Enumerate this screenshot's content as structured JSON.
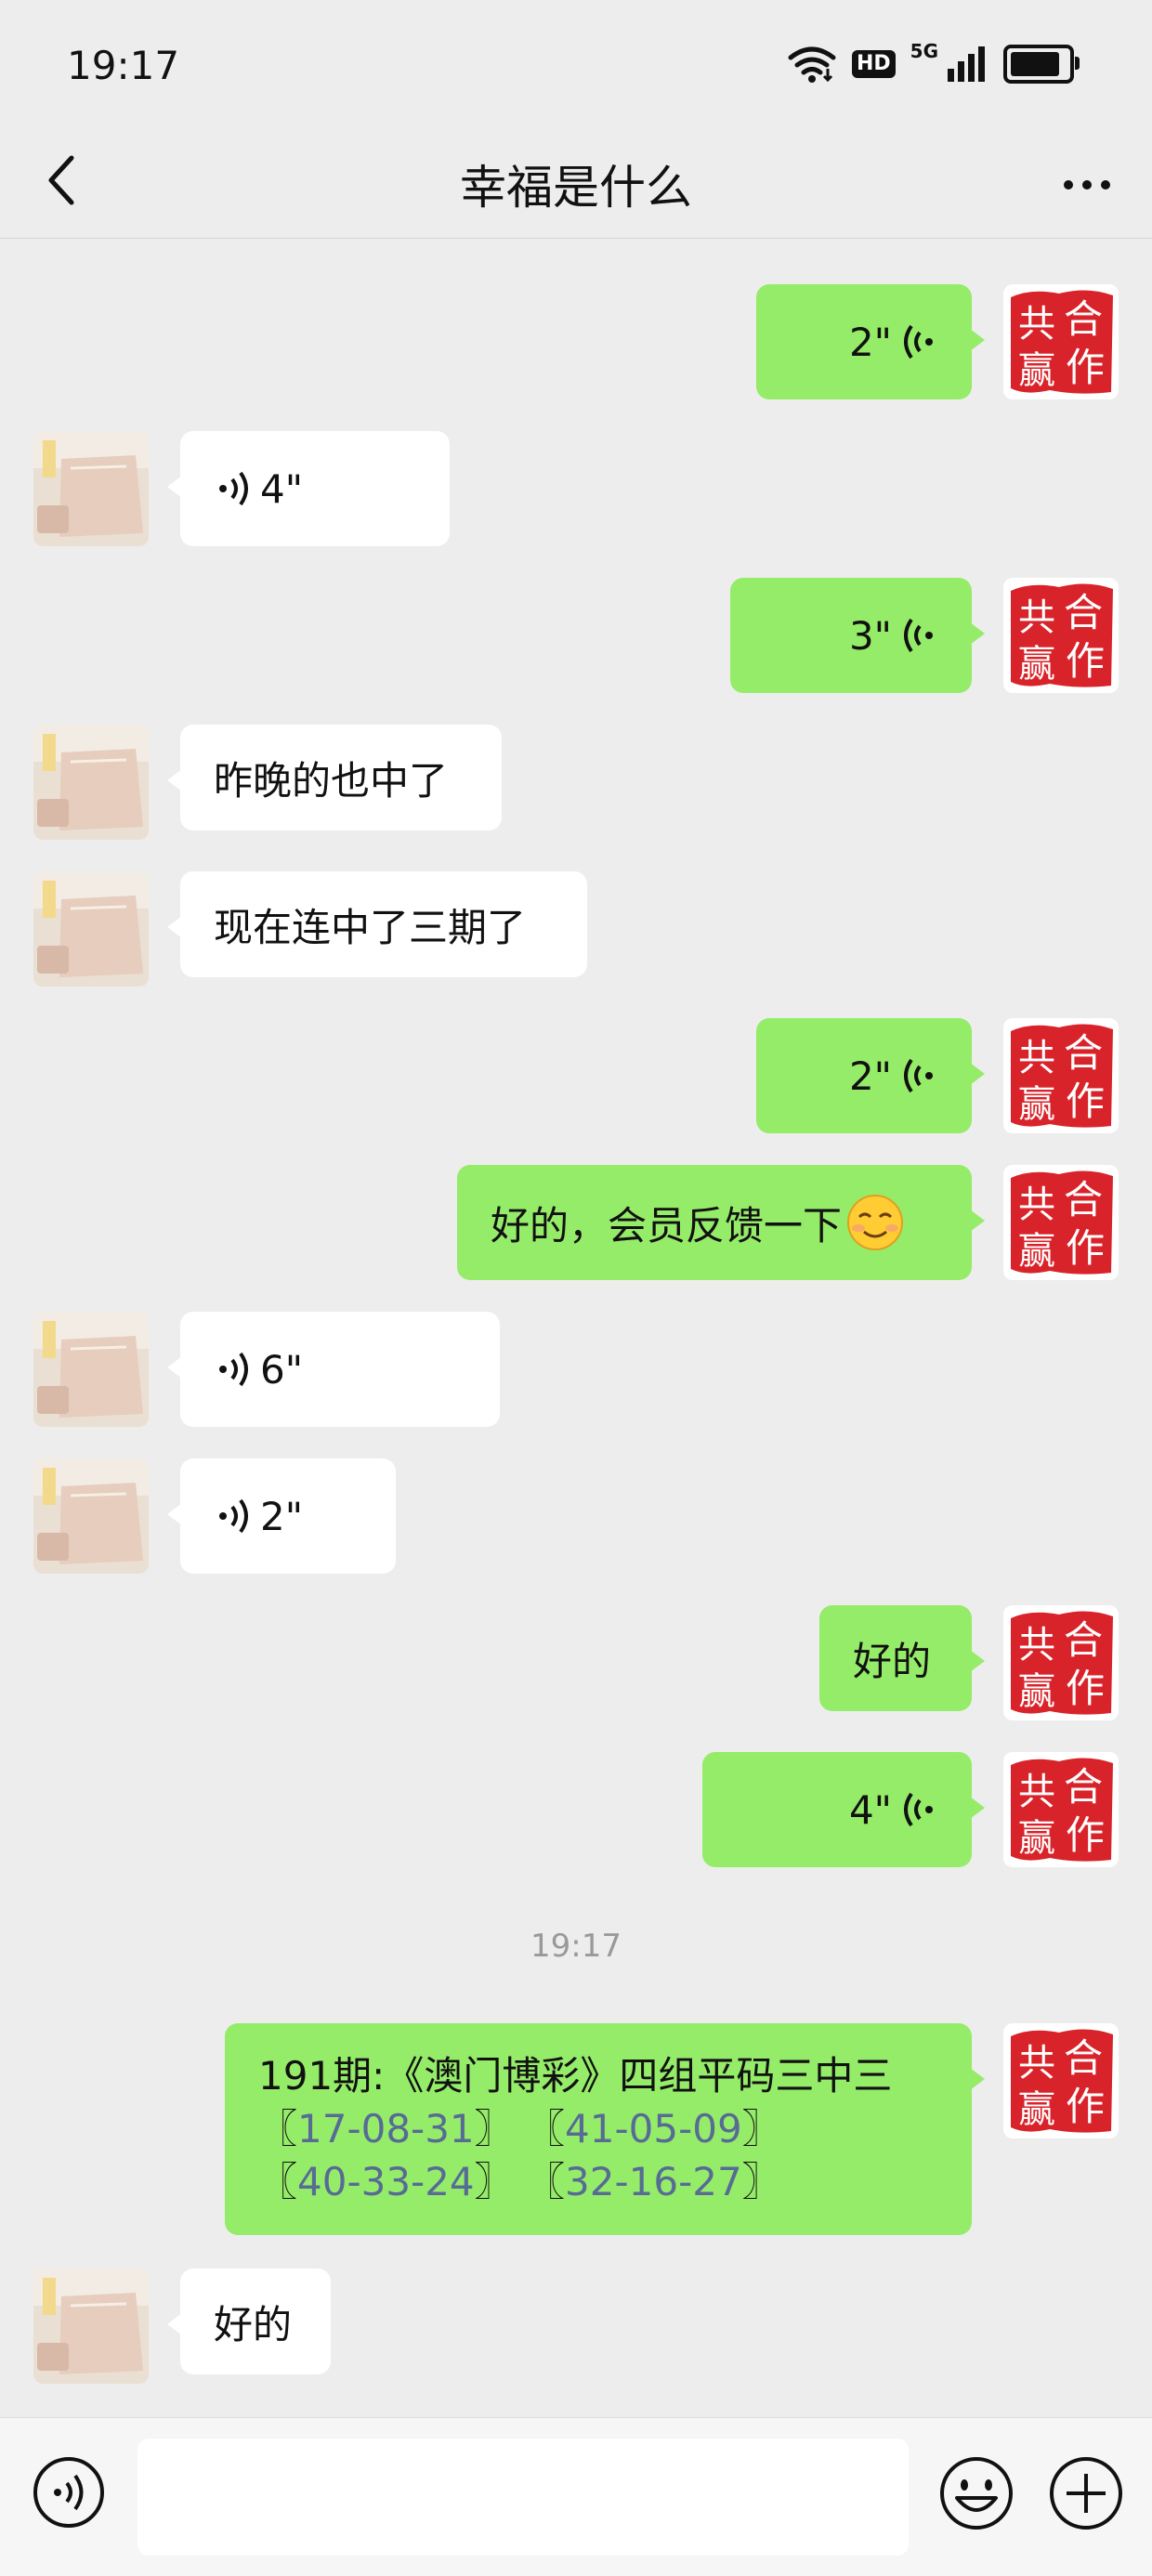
{
  "status_bar": {
    "time": "19:17",
    "hd_label": "HD",
    "network_label": "5G"
  },
  "header": {
    "title": "幸福是什么"
  },
  "messages": [
    {
      "side": "self",
      "type": "voice",
      "duration": "2\""
    },
    {
      "side": "other",
      "type": "voice",
      "duration": "4\""
    },
    {
      "side": "self",
      "type": "voice",
      "duration": "3\""
    },
    {
      "side": "other",
      "type": "text",
      "text": "昨晚的也中了"
    },
    {
      "side": "other",
      "type": "text",
      "text": "现在连中了三期了"
    },
    {
      "side": "self",
      "type": "voice",
      "duration": "2\""
    },
    {
      "side": "self",
      "type": "text",
      "text": "好的，会员反馈一下",
      "emoji": "smiling-face"
    },
    {
      "side": "other",
      "type": "voice",
      "duration": "6\""
    },
    {
      "side": "other",
      "type": "voice",
      "duration": "2\""
    },
    {
      "side": "self",
      "type": "text",
      "text": "好的"
    },
    {
      "side": "self",
      "type": "voice",
      "duration": "4\""
    }
  ],
  "timestamp": "19:17",
  "long_message": {
    "line1": "191期:《澳门博彩》四组平码三中三",
    "groups": [
      "17-08-31",
      "41-05-09",
      "40-33-24",
      "32-16-27"
    ],
    "open_bracket": "〖",
    "close_bracket": "〗"
  },
  "last_message": {
    "side": "other",
    "type": "text",
    "text": "好的"
  },
  "avatar_self_seal": {
    "chars": [
      "合",
      "作",
      "共",
      "赢"
    ],
    "color": "#d9232a"
  },
  "avatar_other": {
    "description_color": "#e8d8cc"
  },
  "colors": {
    "self_bubble": "#95ec69",
    "other_bubble": "#ffffff",
    "background": "#ededed",
    "link": "#576b95"
  },
  "input_bar": {
    "placeholder": ""
  }
}
